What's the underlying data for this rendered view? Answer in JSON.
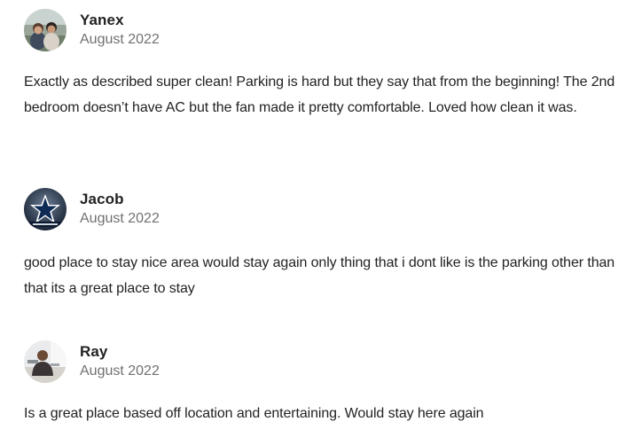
{
  "reviews": [
    {
      "name": "Yanex",
      "date": "August 2022",
      "avatar_icon": "avatar-photo-couple",
      "text": "Exactly as described super clean! Parking is hard but they say that from the beginning! The 2nd bedroom doesn’t have AC but the fan made it pretty comfortable. Loved how clean it was."
    },
    {
      "name": "Jacob",
      "date": "August 2022",
      "avatar_icon": "avatar-star-logo",
      "text": "good place to stay nice area would stay again only thing that i dont like is the parking other than that its a great place to stay"
    },
    {
      "name": "Ray",
      "date": "August 2022",
      "avatar_icon": "avatar-photo-person",
      "text": "Is a great place based off location and entertaining. Would stay here again"
    }
  ],
  "colors": {
    "text_primary": "#222222",
    "text_secondary": "#717171",
    "background": "#ffffff"
  }
}
